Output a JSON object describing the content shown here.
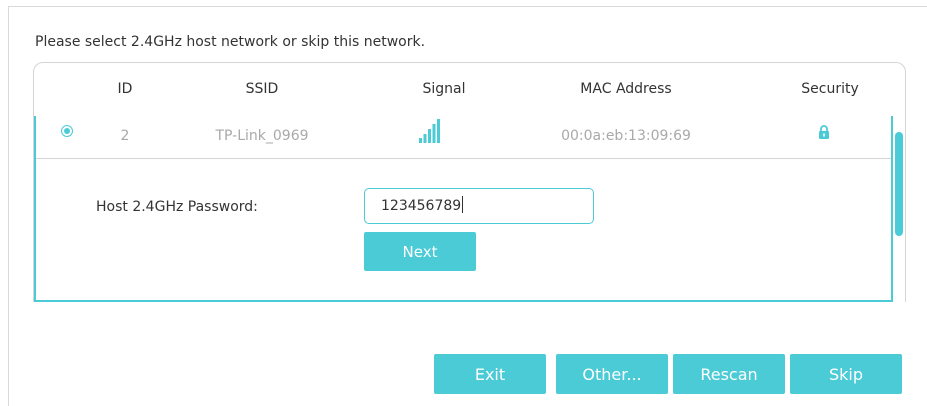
{
  "instruction": "Please select 2.4GHz host network or skip this network.",
  "table": {
    "columns": [
      "ID",
      "SSID",
      "Signal",
      "MAC Address",
      "Security"
    ],
    "rows": [
      {
        "selected": true,
        "id": "2",
        "ssid": "TP-Link_0969",
        "signal_icon": "signal-strength-full-icon",
        "mac": "00:0a:eb:13:09:69",
        "security_icon": "lock-icon"
      }
    ]
  },
  "password": {
    "label": "Host 2.4GHz Password:",
    "value": "123456789"
  },
  "buttons": {
    "next": "Next",
    "exit": "Exit",
    "other": "Other...",
    "rescan": "Rescan",
    "skip": "Skip"
  },
  "colors": {
    "accent": "#4acbd6",
    "muted_text": "#a9a9a9",
    "text": "#333333",
    "border": "#d4d4d4"
  }
}
